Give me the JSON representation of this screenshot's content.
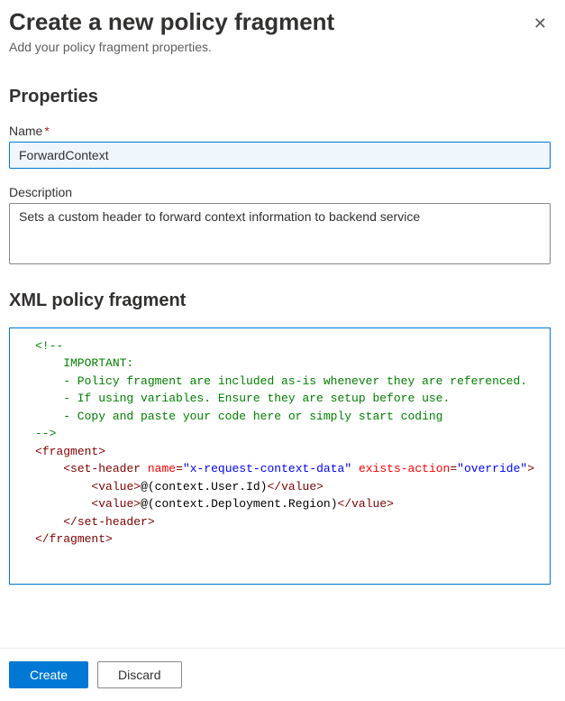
{
  "header": {
    "title": "Create a new policy fragment",
    "subtitle": "Add your policy fragment properties."
  },
  "sections": {
    "properties_heading": "Properties",
    "xml_heading": "XML policy fragment"
  },
  "fields": {
    "name": {
      "label": "Name",
      "required": "*",
      "value": "ForwardContext"
    },
    "description": {
      "label": "Description",
      "value": "Sets a custom header to forward context information to backend service"
    }
  },
  "codeEditor": {
    "lines": [
      {
        "t": "comment",
        "text": "<!--"
      },
      {
        "t": "comment",
        "text": "    IMPORTANT:"
      },
      {
        "t": "comment",
        "text": "    - Policy fragment are included as-is whenever they are referenced."
      },
      {
        "t": "comment",
        "text": "    - If using variables. Ensure they are setup before use."
      },
      {
        "t": "comment",
        "text": "    - Copy and paste your code here or simply start coding"
      },
      {
        "t": "comment",
        "text": "-->"
      },
      {
        "t": "open-tag",
        "indent": 0,
        "name": "fragment",
        "attrs": []
      },
      {
        "t": "open-tag",
        "indent": 1,
        "name": "set-header",
        "attrs": [
          [
            "name",
            "x-request-context-data"
          ],
          [
            "exists-action",
            "override"
          ]
        ]
      },
      {
        "t": "text-tag",
        "indent": 2,
        "name": "value",
        "text": "@(context.User.Id)"
      },
      {
        "t": "text-tag",
        "indent": 2,
        "name": "value",
        "text": "@(context.Deployment.Region)"
      },
      {
        "t": "close-tag",
        "indent": 1,
        "name": "set-header"
      },
      {
        "t": "close-tag",
        "indent": 0,
        "name": "fragment"
      },
      {
        "t": "blank",
        "text": ""
      }
    ]
  },
  "footer": {
    "create_label": "Create",
    "discard_label": "Discard"
  }
}
